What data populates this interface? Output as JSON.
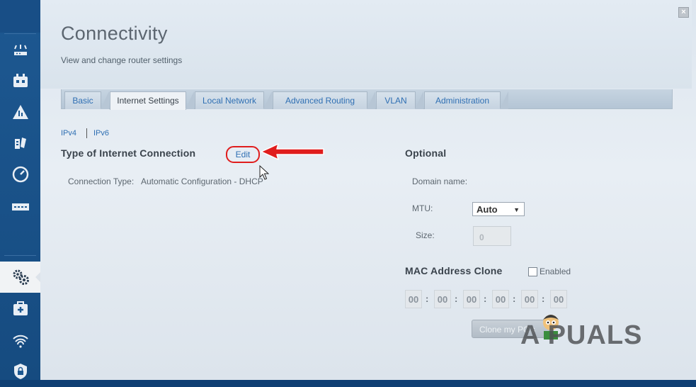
{
  "nav": {
    "icons": [
      "router-icon",
      "devices-icon",
      "alert-icon",
      "parental-controls-icon",
      "speed-test-icon",
      "storage-icon",
      "connectivity-icon",
      "troubleshooting-icon",
      "wireless-icon",
      "security-icon"
    ],
    "active": "connectivity-icon"
  },
  "header": {
    "title": "Connectivity",
    "subtitle": "View and change router settings"
  },
  "tabs": [
    {
      "label": "Basic",
      "active": false
    },
    {
      "label": "Internet Settings",
      "active": true
    },
    {
      "label": "Local Network",
      "active": false
    },
    {
      "label": "Advanced Routing",
      "active": false
    },
    {
      "label": "VLAN",
      "active": false
    },
    {
      "label": "Administration",
      "active": false
    }
  ],
  "ip_toggle": {
    "ipv4": "IPv4",
    "ipv6": "IPv6"
  },
  "internet_connection": {
    "heading": "Type of Internet Connection",
    "edit_label": "Edit",
    "connection_type_label": "Connection Type:",
    "connection_type_value": "Automatic Configuration - DHCP"
  },
  "optional": {
    "heading": "Optional",
    "domain_label": "Domain name:",
    "mtu_label": "MTU:",
    "mtu_value": "Auto",
    "size_label": "Size:",
    "size_value": "0"
  },
  "mac_clone": {
    "heading": "MAC Address Clone",
    "enabled_label": "Enabled",
    "enabled": false,
    "octets": [
      "00",
      "00",
      "00",
      "00",
      "00",
      "00"
    ],
    "button_label": "Clone my PC's"
  },
  "watermark": {
    "text": "A PUALS"
  },
  "colors": {
    "rail": "#1d5891",
    "accent_link": "#2f6fb3",
    "annotation_red": "#e01d1d"
  }
}
